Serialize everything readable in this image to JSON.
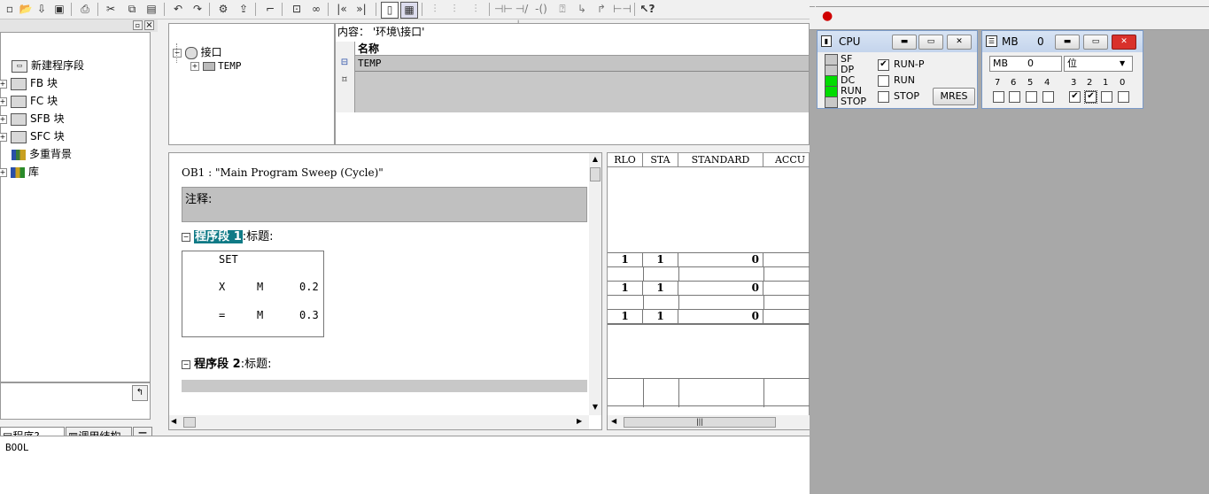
{
  "toolbar": {
    "icons": [
      "new-icon",
      "open-icon",
      "download-icon",
      "save-icon",
      "print-icon",
      "cut-icon",
      "copy-icon",
      "paste-icon",
      "undo-icon",
      "redo-icon",
      "compile-icon",
      "upload-icon",
      "overview-icon",
      "monitor-icon",
      "glasses-icon",
      "step-back-icon",
      "step-forward-icon",
      "ladder-icon",
      "stl-icon",
      "fbd-icon",
      "contact-no-icon",
      "contact-nc-icon",
      "coil-icon",
      "box-icon",
      "branch-open-icon",
      "branch-close-icon",
      "connection-icon",
      "help-icon"
    ]
  },
  "left_panel": {
    "items": [
      {
        "label": "新建程序段",
        "icon": "network-icon"
      },
      {
        "label": "FB 块",
        "icon": "block-icon"
      },
      {
        "label": "FC 块",
        "icon": "block-icon"
      },
      {
        "label": "SFB 块",
        "icon": "block-icon"
      },
      {
        "label": "SFC 块",
        "icon": "block-icon"
      },
      {
        "label": "多重背景",
        "icon": "multi-instance-icon"
      },
      {
        "label": "库",
        "icon": "library-icon"
      }
    ],
    "tabs": [
      "程序?...",
      "调用结构"
    ]
  },
  "interface": {
    "root": "接口",
    "child": "TEMP"
  },
  "content": {
    "path_label": "内容： '环境\\接口'",
    "column_name": "名称",
    "row1": "TEMP"
  },
  "editor": {
    "block_title": "OB1 :  \"Main Program Sweep (Cycle)\"",
    "comment_label": "注释:",
    "network1_prefix": "程序段",
    "network1_num": "1",
    "network1_title": ":标题:",
    "network2_label": "程序段  2",
    "network2_title": ":标题:",
    "stl": [
      {
        "op": "SET",
        "area": "",
        "addr": ""
      },
      {
        "op": "X",
        "area": "M",
        "addr": "0.2"
      },
      {
        "op": "=",
        "area": "M",
        "addr": "0.3"
      }
    ]
  },
  "status": {
    "headers": [
      "RLO",
      "STA",
      "STANDARD",
      "ACCU"
    ],
    "rows": [
      {
        "rlo": "1",
        "sta": "1",
        "standard": "0"
      },
      {
        "rlo": "1",
        "sta": "1",
        "standard": "0"
      },
      {
        "rlo": "1",
        "sta": "1",
        "standard": "0"
      }
    ]
  },
  "bottom": {
    "text": "BOOL"
  },
  "cpu_window": {
    "title": "CPU",
    "leds": [
      {
        "label": "SF",
        "color": "#c8c8c8"
      },
      {
        "label": "DP",
        "color": "#c8c8c8"
      },
      {
        "label": "DC",
        "color": "#00dc00"
      },
      {
        "label": "RUN",
        "color": "#00dc00"
      },
      {
        "label": "STOP",
        "color": "#c8c8c8"
      }
    ],
    "modes": [
      {
        "label": "RUN-P",
        "checked": "✔"
      },
      {
        "label": "RUN",
        "checked": ""
      },
      {
        "label": "STOP",
        "checked": ""
      }
    ],
    "mres_label": "MRES"
  },
  "mb_window": {
    "title": "MB",
    "title_num": "0",
    "area": "MB",
    "area_num": "0",
    "format": "位",
    "bits": [
      {
        "label": "7",
        "checked": ""
      },
      {
        "label": "6",
        "checked": ""
      },
      {
        "label": "5",
        "checked": ""
      },
      {
        "label": "4",
        "checked": ""
      },
      {
        "label": "3",
        "checked": "✔"
      },
      {
        "label": "2",
        "checked": "✔"
      },
      {
        "label": "1",
        "checked": ""
      },
      {
        "label": "0",
        "checked": ""
      }
    ]
  },
  "colors": {
    "highlight": "#0f7a86",
    "led_green": "#00dc00",
    "close_red": "#d9312b"
  }
}
